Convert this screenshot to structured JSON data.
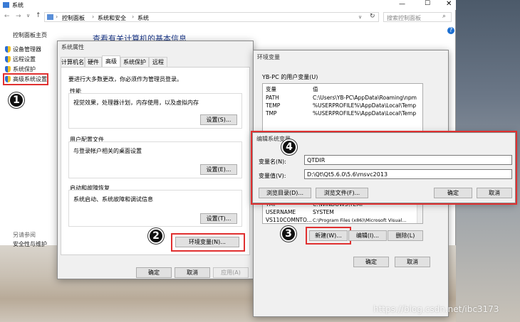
{
  "background_window": {
    "title": "系统",
    "breadcrumb": [
      "控制面板",
      "系统和安全",
      "系统"
    ],
    "search_placeholder": "搜索控制面板",
    "help_icon": "?",
    "page_heading": "查看有关计算机的基本信息",
    "sidebar_home": "控制面板主页",
    "sidebar_items": [
      "设备管理器",
      "远程设置",
      "系统保护",
      "高级系统设置"
    ],
    "see_also_title": "另请参阅",
    "see_also_item": "安全性与维护"
  },
  "sysprops": {
    "title": "系统属性",
    "tabs": [
      "计算机名",
      "硬件",
      "高级",
      "系统保护",
      "远程"
    ],
    "admin_note": "要进行大多数更改，你必须作为管理员登录。",
    "perf_title": "性能",
    "perf_desc": "视觉效果，处理器计划，内存使用，以及虚拟内存",
    "settings_btn": "设置(S)...",
    "profile_title": "用户配置文件",
    "profile_desc": "与登录帐户相关的桌面设置",
    "profile_btn": "设置(E)...",
    "startup_title": "启动和故障恢复",
    "startup_desc": "系统启动、系统故障和调试信息",
    "startup_btn": "设置(T)...",
    "env_btn": "环境变量(N)...",
    "ok": "确定",
    "cancel": "取消",
    "apply": "应用(A)"
  },
  "envvars": {
    "title": "环境变量",
    "user_section": "YB-PC 的用户变量(U)",
    "col_var": "变量",
    "col_val": "值",
    "user_rows": [
      {
        "name": "PATH",
        "value": "C:\\Users\\YB-PC\\AppData\\Roaming\\npm"
      },
      {
        "name": "TEMP",
        "value": "%USERPROFILE%\\AppData\\Local\\Temp"
      },
      {
        "name": "TMP",
        "value": "%USERPROFILE%\\AppData\\Local\\Temp"
      }
    ],
    "sys_rows": [
      {
        "name": "TMP",
        "value": "C:\\WINDOWS\\TEMP"
      },
      {
        "name": "USERNAME",
        "value": "SYSTEM"
      },
      {
        "name": "VS110COMNTO...",
        "value": "C:\\Program Files (x86)\\Microsoft Visual..."
      }
    ],
    "new_btn": "新建(W)...",
    "edit_btn": "编辑(I)...",
    "delete_btn": "删除(L)",
    "ok": "确定",
    "cancel": "取消"
  },
  "editdlg": {
    "title": "编辑系统变量",
    "name_label": "变量名(N):",
    "name_value": "QTDIR",
    "value_label": "变量值(V):",
    "value_value": "D:\\Qt\\Qt5.6.0\\5.6\\msvc2013",
    "browse_dir": "浏览目录(D)...",
    "browse_file": "浏览文件(F)...",
    "ok": "确定",
    "cancel": "取消"
  },
  "markers": [
    "1",
    "2",
    "3",
    "4"
  ],
  "watermark": "https://blog.csdn.net/ibc3173",
  "colors": {
    "accent_red": "#e03030",
    "link_blue": "#1a4fa0"
  }
}
